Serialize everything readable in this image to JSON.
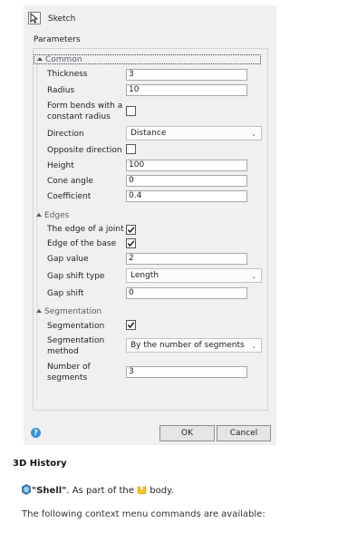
{
  "dialog": {
    "sketch_label": "Sketch",
    "params_label": "Parameters",
    "sections": {
      "common": "Common",
      "edges": "Edges",
      "segmentation": "Segmentation"
    },
    "common": {
      "thickness": {
        "label": "Thickness",
        "value": "3"
      },
      "radius": {
        "label": "Radius",
        "value": "10"
      },
      "form_bends": {
        "label_line1": "Form bends with a",
        "label_line2": "constant radius",
        "checked": false
      },
      "direction": {
        "label": "Direction",
        "value": "Distance"
      },
      "opposite_direction": {
        "label": "Opposite direction",
        "checked": false
      },
      "height": {
        "label": "Height",
        "value": "100"
      },
      "cone_angle": {
        "label": "Cone angle",
        "value": "0"
      },
      "coefficient": {
        "label": "Coefficient",
        "value": "0.4"
      }
    },
    "edges": {
      "edge_of_joint": {
        "label": "The edge of a joint",
        "checked": true
      },
      "edge_of_base": {
        "label": "Edge of the base",
        "checked": true
      },
      "gap_value": {
        "label": "Gap value",
        "value": "2"
      },
      "gap_shift_type": {
        "label": "Gap shift type",
        "value": "Length"
      },
      "gap_shift": {
        "label": "Gap shift",
        "value": "0"
      }
    },
    "segmentation": {
      "segmentation": {
        "label": "Segmentation",
        "checked": true
      },
      "method": {
        "label_line1": "Segmentation",
        "label_line2": "method",
        "value": "By the number of segments"
      },
      "number": {
        "label_line1": "Number of",
        "label_line2": "segments",
        "value": "3"
      }
    },
    "buttons": {
      "help": "?",
      "ok": "OK",
      "cancel": "Cancel"
    }
  },
  "doc": {
    "history_title": "3D History",
    "shell_name": "\"Shell\"",
    "shell_text_a": ". As part of the ",
    "shell_text_b": " body.",
    "note": "The following context menu commands are available:"
  },
  "icons": {
    "sketch": "cursor-arrow-icon",
    "help": "help-icon",
    "shell": "shell-feature-icon",
    "body": "body-icon"
  },
  "colors": {
    "dialog_bg": "#f0f0f0",
    "help_blue": "#3d8fd9",
    "body_yellow": "#f5c518"
  }
}
